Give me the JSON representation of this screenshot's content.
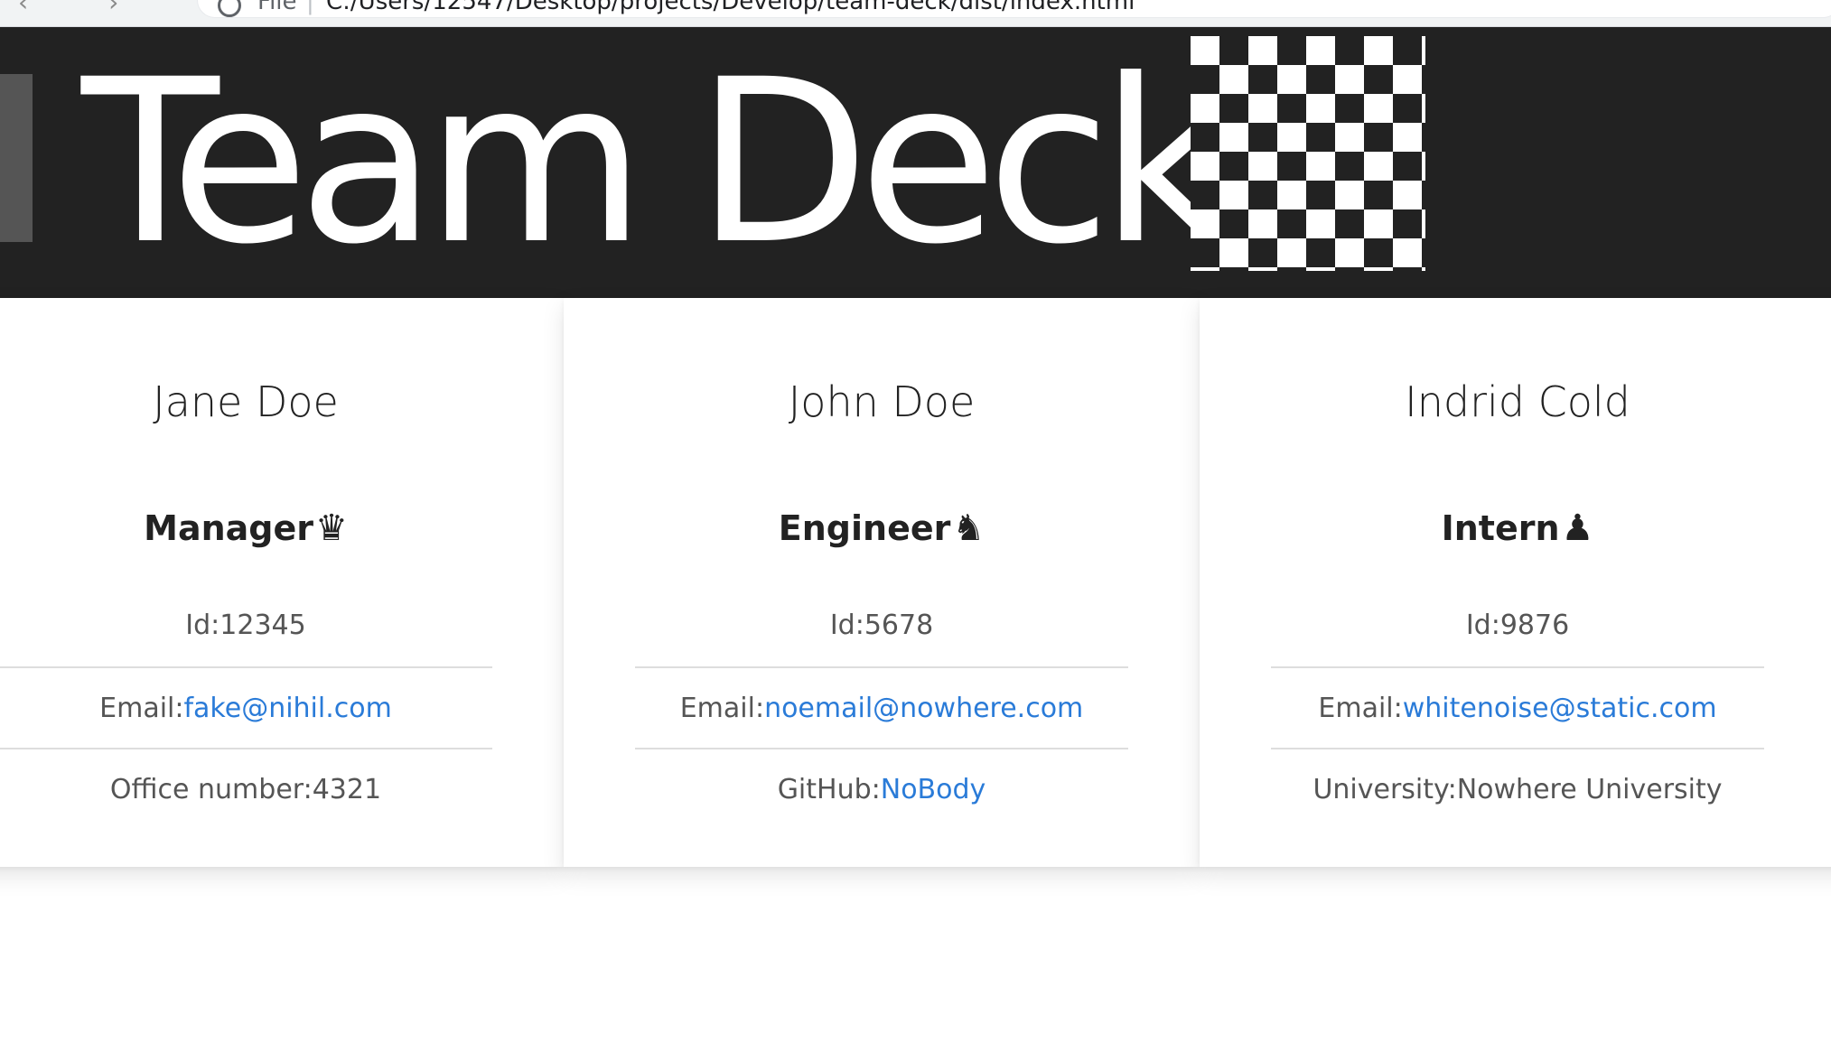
{
  "browser": {
    "nav_icons": "‹ › ⟳",
    "file_label": "File",
    "separator": "|",
    "url": "C:/Users/12547/Desktop/projects/Develop/team-deck/dist/index.html"
  },
  "header": {
    "title": "Team Deck"
  },
  "team": [
    {
      "name": "Jane Doe",
      "role": "Manager",
      "role_icon": "♛",
      "role_icon_name": "chess-queen-icon",
      "id_label": "Id:",
      "id": "12345",
      "email_label": "Email:",
      "email": "fake@nihil.com",
      "extra_label": "Office number:",
      "extra_value": "4321"
    },
    {
      "name": "John Doe",
      "role": "Engineer",
      "role_icon": "♞",
      "role_icon_name": "chess-knight-icon",
      "id_label": "Id:",
      "id": "5678",
      "email_label": "Email:",
      "email": "noemail@nowhere.com",
      "extra_label": "GitHub:",
      "extra_value": "NoBody"
    },
    {
      "name": "Indrid Cold",
      "role": "Intern",
      "role_icon": "♟",
      "role_icon_name": "chess-pawn-icon",
      "id_label": "Id:",
      "id": "9876",
      "email_label": "Email:",
      "email": "whitenoise@static.com",
      "extra_label": "University:",
      "extra_value": "Nowhere University"
    }
  ],
  "colors": {
    "header_bg": "#222222",
    "link": "#2a7bd8",
    "text": "#555555"
  }
}
